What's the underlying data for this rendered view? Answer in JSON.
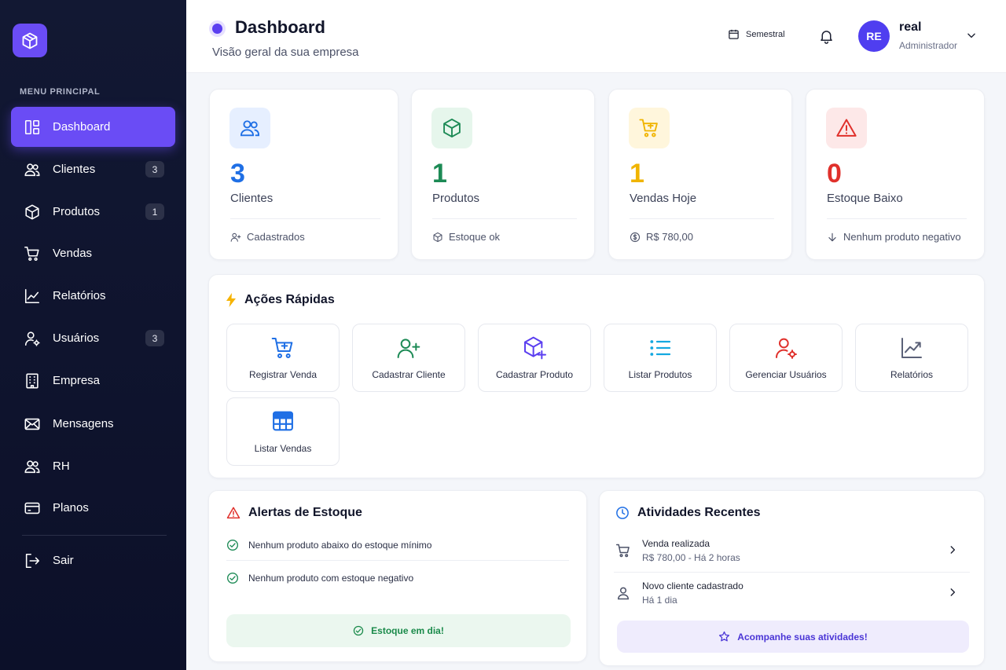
{
  "sidebar": {
    "logo_icon": "cube-icon",
    "menu_title": "MENU PRINCIPAL",
    "items": [
      {
        "label": "Dashboard",
        "icon": "layout-icon",
        "active": true
      },
      {
        "label": "Clientes",
        "icon": "users-icon",
        "badge": "3"
      },
      {
        "label": "Produtos",
        "icon": "cube-icon",
        "badge": "1"
      },
      {
        "label": "Vendas",
        "icon": "cart-icon"
      },
      {
        "label": "Relatórios",
        "icon": "trend-chart-icon"
      },
      {
        "label": "Usuários",
        "icon": "user-gear-icon",
        "badge": "3"
      },
      {
        "label": "Empresa",
        "icon": "building-icon"
      },
      {
        "label": "Mensagens",
        "icon": "mail-icon"
      },
      {
        "label": "RH",
        "icon": "users-icon"
      },
      {
        "label": "Planos",
        "icon": "credit-card-icon"
      }
    ],
    "logout": {
      "label": "Sair",
      "icon": "logout-icon"
    }
  },
  "header": {
    "title": "Dashboard",
    "subtitle": "Visão geral da sua empresa",
    "period": "Semestral",
    "user": {
      "initials": "RE",
      "name": "real",
      "role": "Administrador"
    }
  },
  "stats": [
    {
      "value": "3",
      "label": "Clientes",
      "footer": "Cadastrados",
      "color": "#1f6fe5",
      "bg": "#e6efff",
      "icon": "users-icon",
      "footer_icon": "user-plus-icon"
    },
    {
      "value": "1",
      "label": "Produtos",
      "footer": "Estoque ok",
      "color": "#1c8a55",
      "bg": "#e6f6ec",
      "icon": "cube-icon",
      "footer_icon": "cube-icon"
    },
    {
      "value": "1",
      "label": "Vendas Hoje",
      "footer": "R$ 780,00",
      "color": "#f0b400",
      "bg": "#fff6dc",
      "icon": "cart-icon",
      "footer_icon": "dollar-coin-icon"
    },
    {
      "value": "0",
      "label": "Estoque Baixo",
      "footer": "Nenhum produto negativo",
      "color": "#e0302b",
      "bg": "#fde8e8",
      "icon": "warning-icon",
      "footer_icon": "arrow-down-icon"
    }
  ],
  "quick_actions": {
    "title": "Ações Rápidas",
    "items": [
      {
        "label": "Registrar Venda",
        "icon": "cart-plus-icon"
      },
      {
        "label": "Cadastrar Cliente",
        "icon": "user-plus-icon"
      },
      {
        "label": "Cadastrar Produto",
        "icon": "cube-plus-icon"
      },
      {
        "label": "Listar Produtos",
        "icon": "list-icon"
      },
      {
        "label": "Gerenciar Usuários",
        "icon": "user-gear-icon"
      },
      {
        "label": "Relatórios",
        "icon": "trend-chart-icon"
      },
      {
        "label": "Listar Vendas",
        "icon": "table-icon"
      }
    ]
  },
  "stock_alerts": {
    "title": "Alertas de Estoque",
    "items": [
      "Nenhum produto abaixo do estoque mínimo",
      "Nenhum produto com estoque negativo"
    ],
    "status": "Estoque em dia!"
  },
  "activities": {
    "title": "Atividades Recentes",
    "items": [
      {
        "title": "Venda realizada",
        "subtitle": "R$ 780,00 - Há 2 horas",
        "icon": "cart-icon"
      },
      {
        "title": "Novo cliente cadastrado",
        "subtitle": "Há 1 dia",
        "icon": "user-icon"
      }
    ],
    "footer": "Acompanhe suas atividades!"
  }
}
